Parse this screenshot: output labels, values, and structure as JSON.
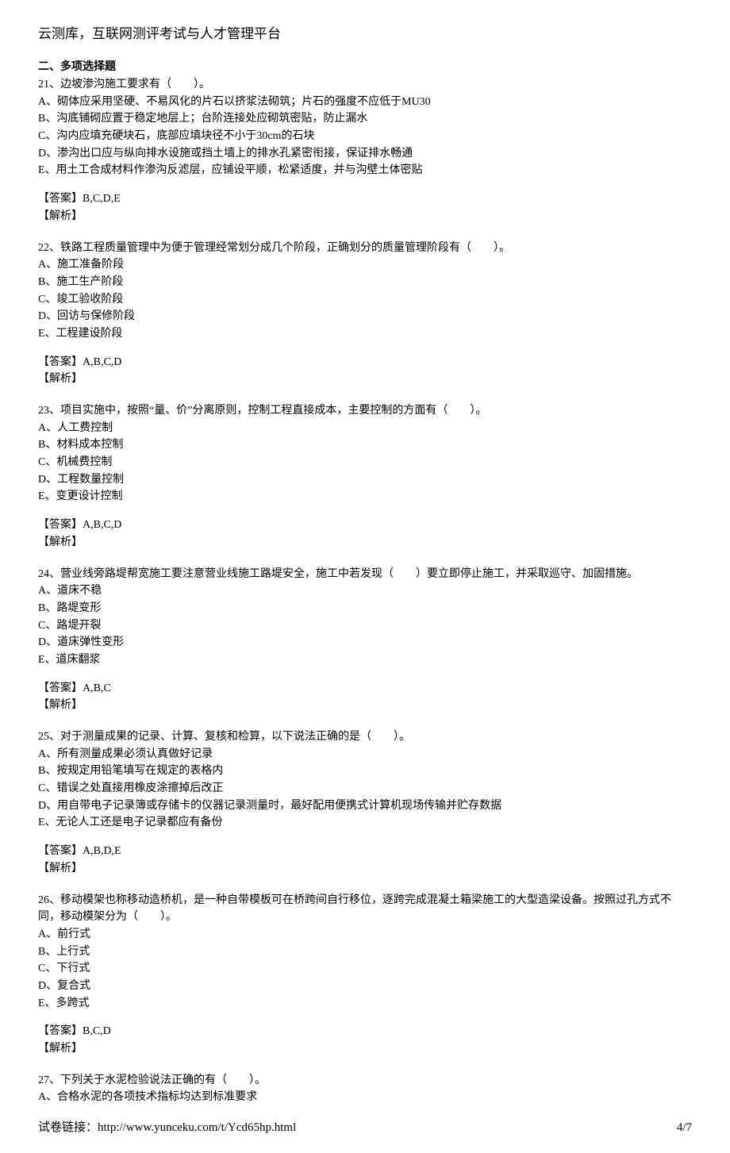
{
  "header": {
    "title": "云测库，互联网测评考试与人才管理平台"
  },
  "section_heading": "二、多项选择题",
  "questions": [
    {
      "stem": "21、边坡渗沟施工要求有（　　）。",
      "options": [
        "A、砌体应采用坚硬、不易风化的片石以挤浆法砌筑；片石的强度不应低于MU30",
        "B、沟底铺砌应置于稳定地层上；台阶连接处应砌筑密贴，防止漏水",
        "C、沟内应填充硬块石，底部应填块径不小于30cm的石块",
        "D、渗沟出口应与纵向排水设施或挡土墙上的排水孔紧密衔接，保证排水畅通",
        "E、用土工合成材料作渗沟反滤层，应铺设平顺，松紧适度，并与沟壁土体密贴"
      ],
      "answer": "【答案】B,C,D,E",
      "analysis": "【解析】"
    },
    {
      "stem": "22、铁路工程质量管理中为便于管理经常划分成几个阶段，正确划分的质量管理阶段有（　　）。",
      "options": [
        "A、施工准备阶段",
        "B、施工生产阶段",
        "C、竣工验收阶段",
        "D、回访与保修阶段",
        "E、工程建设阶段"
      ],
      "answer": "【答案】A,B,C,D",
      "analysis": "【解析】"
    },
    {
      "stem": "23、项目实施中，按照“量、价”分离原则，控制工程直接成本，主要控制的方面有（　　）。",
      "options": [
        "A、人工费控制",
        "B、材料成本控制",
        "C、机械费控制",
        "D、工程数量控制",
        "E、变更设计控制"
      ],
      "answer": "【答案】A,B,C,D",
      "analysis": "【解析】"
    },
    {
      "stem": "24、营业线旁路堤帮宽施工要注意营业线施工路堤安全，施工中若发现（　　）要立即停止施工，并采取巡守、加固措施。",
      "options": [
        "A、道床不稳",
        "B、路堤变形",
        "C、路堤开裂",
        "D、道床弹性变形",
        "E、道床翻浆"
      ],
      "answer": "【答案】A,B,C",
      "analysis": "【解析】"
    },
    {
      "stem": "25、对于测量成果的记录、计算、复核和检算，以下说法正确的是（　　）。",
      "options": [
        "A、所有测量成果必须认真做好记录",
        "B、按规定用铅笔填写在规定的表格内",
        "C、错误之处直接用橡皮涂擦掉后改正",
        "D、用自带电子记录簿或存储卡的仪器记录测量时，最好配用便携式计算机现场传输并贮存数据",
        "E、无论人工还是电子记录都应有备份"
      ],
      "answer": "【答案】A,B,D,E",
      "analysis": "【解析】"
    },
    {
      "stem": "26、移动模架也称移动造桥机，是一种自带模板可在桥跨间自行移位，逐跨完成混凝土箱梁施工的大型造梁设备。按照过孔方式不同，移动模架分为（　　）。",
      "options": [
        "A、前行式",
        "B、上行式",
        "C、下行式",
        "D、复合式",
        "E、多跨式"
      ],
      "answer": "【答案】B,C,D",
      "analysis": "【解析】"
    },
    {
      "stem": "27、下列关于水泥检验说法正确的有（　　）。",
      "options": [
        "A、合格水泥的各项技术指标均达到标准要求"
      ],
      "answer": "",
      "analysis": ""
    }
  ],
  "footer": {
    "link_label": "试卷链接：http://www.yunceku.com/t/Ycd65hp.html",
    "page": "4/7"
  }
}
